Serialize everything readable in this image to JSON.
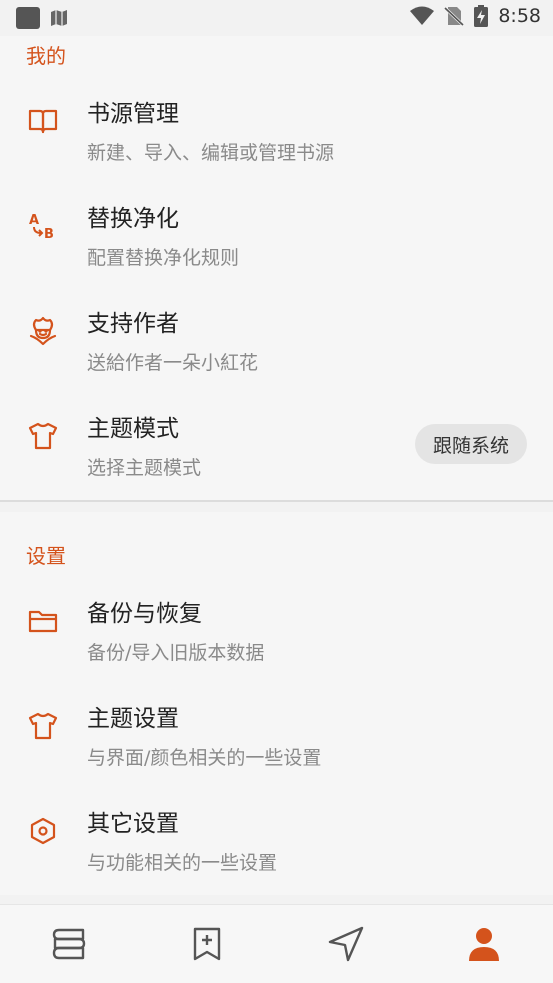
{
  "status_bar": {
    "time": "8:58"
  },
  "sections": [
    {
      "title": "我的",
      "items": [
        {
          "icon": "book-icon",
          "title": "书源管理",
          "subtitle": "新建、导入、编辑或管理书源"
        },
        {
          "icon": "replace-ab-icon",
          "title": "替换净化",
          "subtitle": "配置替换净化规则"
        },
        {
          "icon": "flower-icon",
          "title": "支持作者",
          "subtitle": "送給作者一朵小紅花"
        },
        {
          "icon": "tshirt-icon",
          "title": "主题模式",
          "subtitle": "选择主题模式",
          "chip": "跟随系统"
        }
      ]
    },
    {
      "title": "设置",
      "items": [
        {
          "icon": "folder-icon",
          "title": "备份与恢复",
          "subtitle": "备份/导入旧版本数据"
        },
        {
          "icon": "tshirt-icon",
          "title": "主题设置",
          "subtitle": "与界面/颜色相关的一些设置"
        },
        {
          "icon": "hexagon-icon",
          "title": "其它设置",
          "subtitle": "与功能相关的一些设置"
        }
      ]
    }
  ],
  "bottom_nav": [
    {
      "name": "bookshelf",
      "icon": "bookshelf-icon",
      "active": false
    },
    {
      "name": "explore",
      "icon": "bookmark-add-icon",
      "active": false
    },
    {
      "name": "rss",
      "icon": "navigation-icon",
      "active": false
    },
    {
      "name": "my",
      "icon": "person-icon",
      "active": true
    }
  ],
  "colors": {
    "accent": "#d4531c",
    "icon_gray": "#555555",
    "subtitle": "#8a8a8a"
  }
}
